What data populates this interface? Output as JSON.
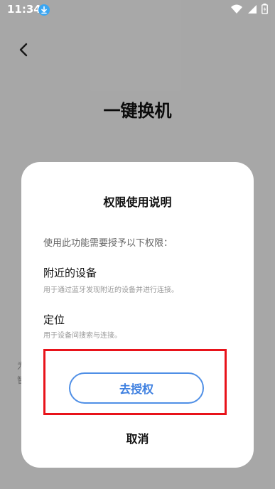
{
  "status_bar": {
    "time": "11:34",
    "icons": [
      "download-icon",
      "wifi-icon",
      "signal-icon",
      "battery-icon"
    ]
  },
  "screen": {
    "title": "一键换机",
    "hint_1": "为",
    "hint_2": "智"
  },
  "dialog": {
    "title": "权限使用说明",
    "intro": "使用此功能需要授予以下权限：",
    "permissions": [
      {
        "title": "附近的设备",
        "description": "用于通过蓝牙发现附近的设备并进行连接。"
      },
      {
        "title": "定位",
        "description": "用于设备间搜索与连接。"
      }
    ],
    "authorize_label": "去授权",
    "cancel_label": "取消"
  },
  "colors": {
    "accent": "#4f8fe6",
    "highlight": "#e8131a"
  }
}
